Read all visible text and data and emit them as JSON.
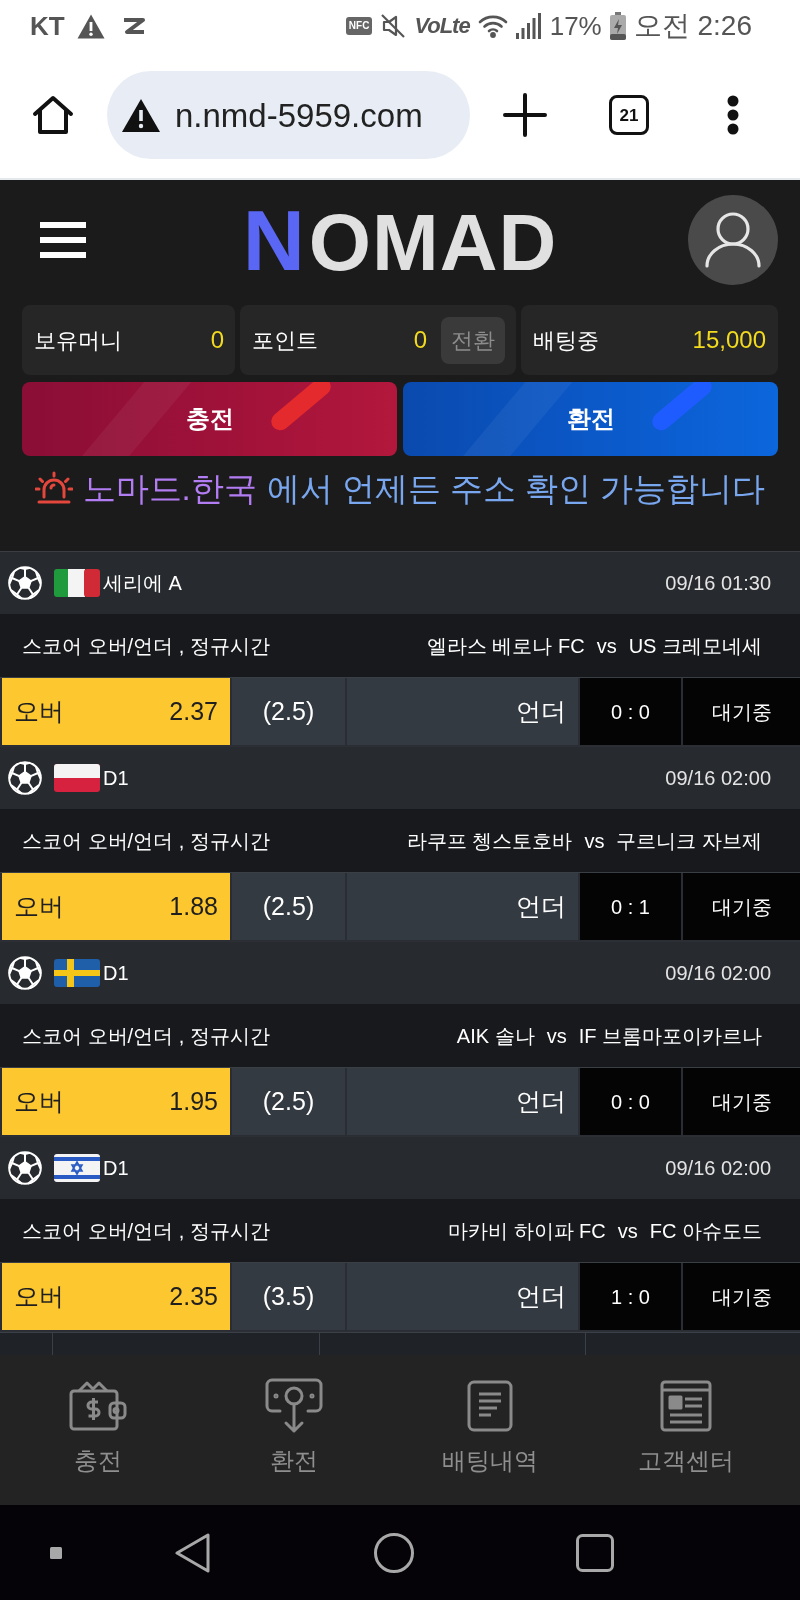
{
  "status_bar": {
    "carrier": "KT",
    "nfc": "NFC",
    "volte": "VoLte",
    "battery": "17%",
    "time": "오전 2:26"
  },
  "browser": {
    "url": "n.nmd-5959.com",
    "tab_count": "21"
  },
  "header": {
    "logo": {
      "mark": "N",
      "wordmark": "OMAD"
    }
  },
  "balances": [
    {
      "label": "보유머니",
      "value": "0"
    },
    {
      "label": "포인트",
      "value": "0",
      "action": "전환"
    },
    {
      "label": "배팅중",
      "value": "15,000"
    }
  ],
  "actions": [
    {
      "label": "충전",
      "kind": "deposit"
    },
    {
      "label": "환전",
      "kind": "withdraw"
    }
  ],
  "notice": {
    "highlight": "노마드.한국",
    "message": "에서 언제든 주소 확인 가능합니다"
  },
  "matches": [
    {
      "league": {
        "flag": {
          "kind": "italy"
        },
        "name": "세리에 A"
      },
      "date": "09/16 01:30",
      "market": "스코어 오버/언더 , 정규시간",
      "home": "엘라스 베로나 FC",
      "separator": "vs",
      "away": "US 크레모네세",
      "over": {
        "label": "오버",
        "odds": "2.37",
        "selected": true
      },
      "line": "(2.5)",
      "under": {
        "label": "언더",
        "selected": false
      },
      "score": "0 : 0",
      "status": "대기중"
    },
    {
      "league": {
        "flag": {
          "kind": "poland"
        },
        "name": "D1"
      },
      "date": "09/16 02:00",
      "market": "스코어 오버/언더 , 정규시간",
      "home": "라쿠프 쳉스토호바",
      "separator": "vs",
      "away": "구르니크 자브제",
      "over": {
        "label": "오버",
        "odds": "1.88",
        "selected": true
      },
      "line": "(2.5)",
      "under": {
        "label": "언더",
        "selected": false
      },
      "score": "0 : 1",
      "status": "대기중"
    },
    {
      "league": {
        "flag": {
          "kind": "sweden"
        },
        "name": "D1"
      },
      "date": "09/16 02:00",
      "market": "스코어 오버/언더 , 정규시간",
      "home": "AIK 솔나",
      "separator": "vs",
      "away": "IF 브롬마포이카르나",
      "over": {
        "label": "오버",
        "odds": "1.95",
        "selected": true
      },
      "line": "(2.5)",
      "under": {
        "label": "언더",
        "selected": false
      },
      "score": "0 : 0",
      "status": "대기중"
    },
    {
      "league": {
        "flag": {
          "kind": "israel"
        },
        "name": "D1"
      },
      "date": "09/16 02:00",
      "market": "스코어 오버/언더 , 정규시간",
      "home": "마카비 하이파 FC",
      "separator": "vs",
      "away": "FC 아슈도드",
      "over": {
        "label": "오버",
        "odds": "2.35",
        "selected": true
      },
      "line": "(3.5)",
      "under": {
        "label": "언더",
        "selected": false
      },
      "score": "1 : 0",
      "status": "대기중"
    }
  ],
  "bottom_nav": [
    {
      "label": "충전"
    },
    {
      "label": "환전"
    },
    {
      "label": "배팅내역"
    },
    {
      "label": "고객센터"
    }
  ]
}
